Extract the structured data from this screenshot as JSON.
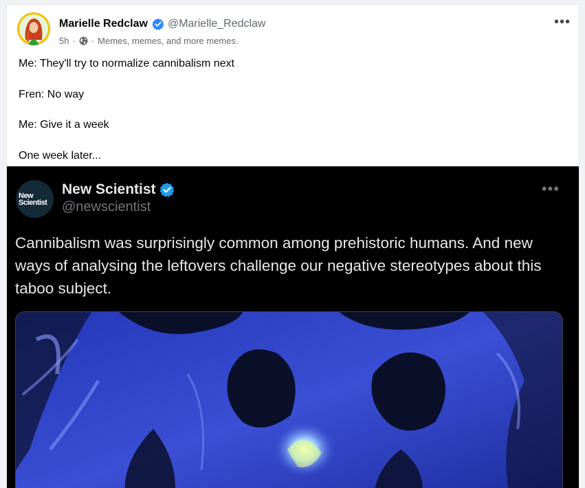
{
  "post": {
    "author_name": "Marielle Redclaw",
    "author_handle": "@Marielle_Redclaw",
    "time": "5h",
    "separator": "·",
    "group": "Memes, memes, and more memes.",
    "lines": [
      "Me: They'll try to normalize cannibalism next",
      "Fren: No way",
      "Me: Give it a week",
      "One week later..."
    ],
    "more_label": "•••",
    "icons": {
      "verified": "verified-badge-icon",
      "globe": "globe-icon",
      "more": "more-options-icon"
    }
  },
  "embedded_tweet": {
    "logo_lines": [
      "New",
      "Scientist"
    ],
    "name": "New Scientist",
    "handle": "@newscientist",
    "more_label": "•••",
    "text": "Cannibalism was surprisingly common among prehistoric humans. And new ways of analysing the leftovers challenge our negative stereotypes about this taboo subject.",
    "image_description_icon": "skull-artwork-image"
  },
  "colors": {
    "verified_blue": "#1d9bf0",
    "fb_verified_blue": "#2d88ff",
    "skull_dark": "#0a0f2a",
    "skull_mid": "#3b4fd6",
    "skull_light": "#8e9fff"
  }
}
